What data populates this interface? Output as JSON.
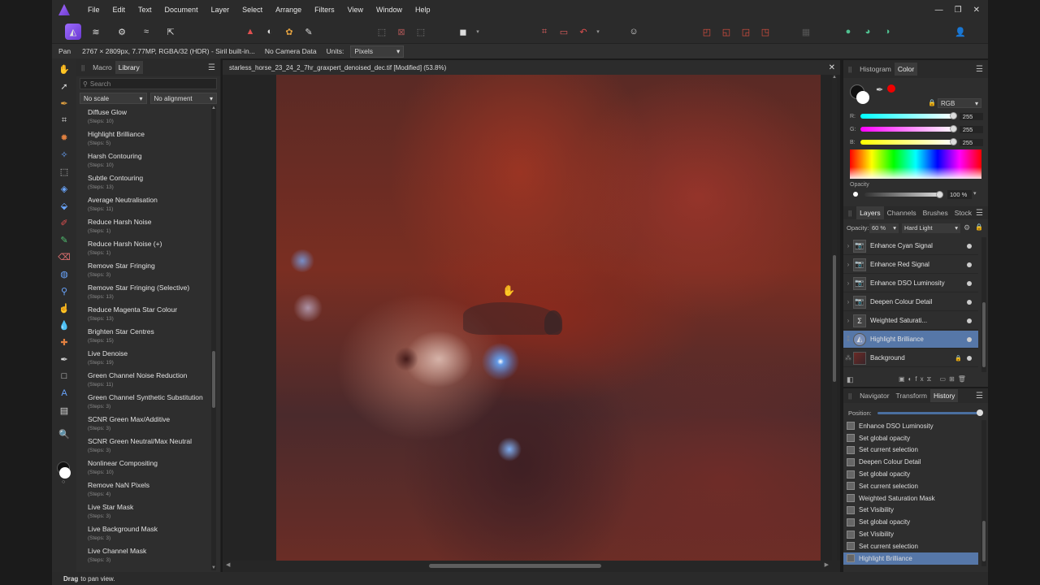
{
  "menu": [
    "File",
    "Edit",
    "Text",
    "Document",
    "Layer",
    "Select",
    "Arrange",
    "Filters",
    "View",
    "Window",
    "Help"
  ],
  "context": {
    "tool": "Pan",
    "image_info": "2767 × 2809px, 7.77MP, RGBA/32 (HDR) - Siril built-in...",
    "camera": "No Camera Data",
    "units_label": "Units:",
    "units_value": "Pixels"
  },
  "left_panel": {
    "tabs": [
      "Macro",
      "Library"
    ],
    "search_placeholder": "Search",
    "scale_select": "No scale",
    "align_select": "No alignment",
    "macros": [
      {
        "name": "Diffuse Glow",
        "steps": "(Steps: 10)"
      },
      {
        "name": "Highlight Brilliance",
        "steps": "(Steps: 5)"
      },
      {
        "name": "Harsh Contouring",
        "steps": "(Steps: 10)"
      },
      {
        "name": "Subtle Contouring",
        "steps": "(Steps: 13)"
      },
      {
        "name": "Average Neutralisation",
        "steps": "(Steps: 11)"
      },
      {
        "name": "Reduce Harsh Noise",
        "steps": "(Steps: 1)"
      },
      {
        "name": "Reduce Harsh Noise (+)",
        "steps": "(Steps: 1)"
      },
      {
        "name": "Remove Star Fringing",
        "steps": "(Steps: 3)"
      },
      {
        "name": "Remove Star Fringing (Selective)",
        "steps": "(Steps: 13)"
      },
      {
        "name": "Reduce Magenta Star Colour",
        "steps": "(Steps: 13)"
      },
      {
        "name": "Brighten Star Centres",
        "steps": "(Steps: 15)"
      },
      {
        "name": "Live Denoise",
        "steps": "(Steps: 19)"
      },
      {
        "name": "Green Channel Noise Reduction",
        "steps": "(Steps: 11)"
      },
      {
        "name": "Green Channel Synthetic Substitution",
        "steps": "(Steps: 3)"
      },
      {
        "name": "SCNR Green Max/Additive",
        "steps": "(Steps: 3)"
      },
      {
        "name": "SCNR Green Neutral/Max Neutral",
        "steps": "(Steps: 3)"
      },
      {
        "name": "Nonlinear Compositing",
        "steps": "(Steps: 10)"
      },
      {
        "name": "Remove NaN Pixels",
        "steps": "(Steps: 4)"
      },
      {
        "name": "Live Star Mask",
        "steps": "(Steps: 3)"
      },
      {
        "name": "Live Background Mask",
        "steps": "(Steps: 3)"
      },
      {
        "name": "Live Channel Mask",
        "steps": "(Steps: 3)"
      }
    ]
  },
  "document": {
    "title": "starless_horse_23_24_2_7hr_graxpert_denoised_dec.tif [Modified] (53.8%)"
  },
  "color_panel": {
    "tabs": [
      "Histogram",
      "Color"
    ],
    "mode": "RGB",
    "r_label": "R:",
    "r_value": "255",
    "g_label": "G:",
    "g_value": "255",
    "b_label": "B:",
    "b_value": "255",
    "opacity_label": "Opacity",
    "opacity_value": "100 %"
  },
  "layers_panel": {
    "tabs": [
      "Layers",
      "Channels",
      "Brushes",
      "Stock"
    ],
    "opacity_label": "Opacity:",
    "opacity_value": "60 %",
    "blend_mode": "Hard Light",
    "layers": [
      {
        "name": "Enhance Cyan Signal",
        "selected": false
      },
      {
        "name": "Enhance Red Signal",
        "selected": false
      },
      {
        "name": "Enhance DSO Luminosity",
        "selected": false
      },
      {
        "name": "Deepen Colour Detail",
        "selected": false
      },
      {
        "name": "Weighted Saturati...",
        "selected": false
      },
      {
        "name": "Highlight Brilliance",
        "selected": true
      },
      {
        "name": "Background",
        "selected": false
      }
    ]
  },
  "history_panel": {
    "tabs": [
      "Navigator",
      "Transform",
      "History"
    ],
    "position_label": "Position:",
    "position_fraction": 1.0,
    "entries": [
      {
        "name": "Enhance DSO Luminosity",
        "selected": false
      },
      {
        "name": "Set global opacity",
        "selected": false
      },
      {
        "name": "Set current selection",
        "selected": false
      },
      {
        "name": "Deepen Colour Detail",
        "selected": false
      },
      {
        "name": "Set global opacity",
        "selected": false
      },
      {
        "name": "Set current selection",
        "selected": false
      },
      {
        "name": "Weighted Saturation Mask",
        "selected": false
      },
      {
        "name": "Set Visibility",
        "selected": false
      },
      {
        "name": "Set global opacity",
        "selected": false
      },
      {
        "name": "Set Visibility",
        "selected": false
      },
      {
        "name": "Set current selection",
        "selected": false
      },
      {
        "name": "Highlight Brilliance",
        "selected": true
      }
    ]
  },
  "status": {
    "bold": "Drag",
    "text": "to pan view."
  },
  "colors": {
    "selection": "#5677a8",
    "accent": "#8a5cf0"
  }
}
